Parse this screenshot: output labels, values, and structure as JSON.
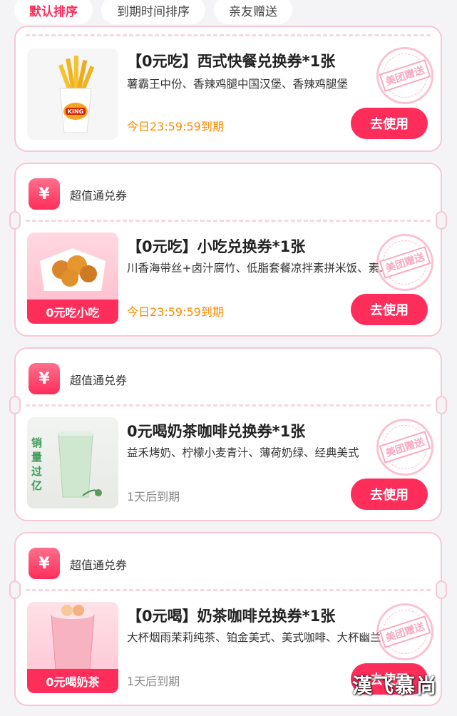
{
  "tabs": [
    {
      "label": "默认排序",
      "active": true
    },
    {
      "label": "到期时间排序",
      "active": false
    },
    {
      "label": "亲友赠送",
      "active": false
    }
  ],
  "stamp_text": "美团赠送",
  "coupons": [
    {
      "header": null,
      "thumb_label": "",
      "thumb_image": "burger-king-fries",
      "title": "【0元吃】西式快餐兑换券*1张",
      "desc": "薯霸王中份、香辣鸡腿中国汉堡、香辣鸡腿堡",
      "expire": "今日23:59:59到期",
      "button": "去使用"
    },
    {
      "header": "超值通兑券",
      "thumb_label": "0元吃小吃",
      "thumb_image": "fried-chicken-snack",
      "title": "【0元吃】小吃兑换券*1张",
      "desc": "川香海带丝+卤汁腐竹、低脂套餐凉拌素拼米饭、素...",
      "expire": "今日23:59:59到期",
      "button": "去使用"
    },
    {
      "header": "超值通兑券",
      "thumb_label": "",
      "thumb_image": "matcha-milk-tea",
      "thumb_text": "销量过亿",
      "title": "0元喝奶茶咖啡兑换券*1张",
      "desc": "益禾烤奶、柠檬小麦青汁、薄荷奶绿、经典美式",
      "expire": "1天后到期",
      "button": "去使用"
    },
    {
      "header": "超值通兑券",
      "thumb_label": "0元喝奶茶",
      "thumb_image": "peach-milk-tea",
      "title": "【0元喝】奶茶咖啡兑换券*1张",
      "desc": "大杯烟雨茉莉纯茶、铂金美式、美式咖啡、大杯幽兰...",
      "expire": "1天后到期",
      "button": "去使用"
    }
  ],
  "watermark": "漢飞慕尚",
  "colors": {
    "accent": "#ff2d5a",
    "expire_today": "#ff8a00",
    "expire_later": "#888888",
    "border": "#f7c7d4"
  }
}
